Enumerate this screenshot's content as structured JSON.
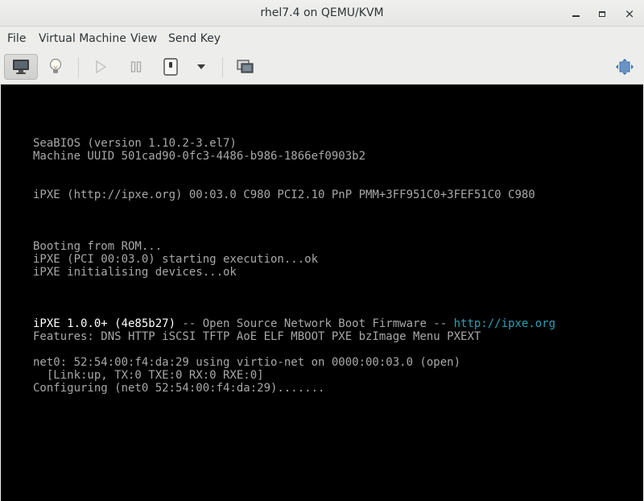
{
  "window": {
    "title": "rhel7.4 on QEMU/KVM",
    "controls": {
      "minimize": "minimize",
      "maximize": "maximize",
      "close": "×"
    }
  },
  "menubar": {
    "items": [
      "File",
      "Virtual Machine",
      "View",
      "Send Key"
    ]
  },
  "toolbar": {
    "buttons": [
      {
        "name": "console",
        "icon": "monitor-icon",
        "active": true
      },
      {
        "name": "details",
        "icon": "lightbulb-icon",
        "active": false
      },
      {
        "name": "run",
        "icon": "play-icon",
        "enabled": false
      },
      {
        "name": "pause",
        "icon": "pause-icon",
        "enabled": false
      },
      {
        "name": "shutdown",
        "icon": "power-icon",
        "enabled": true
      },
      {
        "name": "shutdown-menu",
        "icon": "dropdown-arrow-icon",
        "enabled": true
      },
      {
        "name": "snapshots",
        "icon": "snapshots-icon",
        "enabled": true
      },
      {
        "name": "fullscreen",
        "icon": "fullscreen-icon",
        "enabled": true
      }
    ]
  },
  "console": {
    "seabios_version": "SeaBIOS (version 1.10.2-3.el7)",
    "machine_uuid": "Machine UUID 501cad90-0fc3-4486-b986-1866ef0903b2",
    "ipxe_pci_line": "iPXE (http://ipxe.org) 00:03.0 C980 PCI2.10 PnP PMM+3FF951C0+3FEF51C0 C980",
    "booting_rom": "Booting from ROM...",
    "ipxe_execution": "iPXE (PCI 00:03.0) starting execution...ok",
    "ipxe_init": "iPXE initialising devices...ok",
    "ipxe_version": "iPXE 1.0.0+ (4e85b27)",
    "ipxe_version_separator": " -- Open Source Network Boot Firmware -- ",
    "ipxe_url": "http://ipxe.org",
    "features": "Features: DNS HTTP iSCSI TFTP AoE ELF MBOOT PXE bzImage Menu PXEXT",
    "net0": "net0: 52:54:00:f4:da:29 using virtio-net on 0000:00:03.0 (open)",
    "link_status": "  [Link:up, TX:0 TXE:0 RX:0 RXE:0]",
    "configuring": "Configuring (net0 52:54:00:f4:da:29)......."
  },
  "colors": {
    "console_bg": "#000000",
    "console_text": "#a8a8a8",
    "console_bright": "#ffffff",
    "console_link": "#2aa1b3"
  }
}
